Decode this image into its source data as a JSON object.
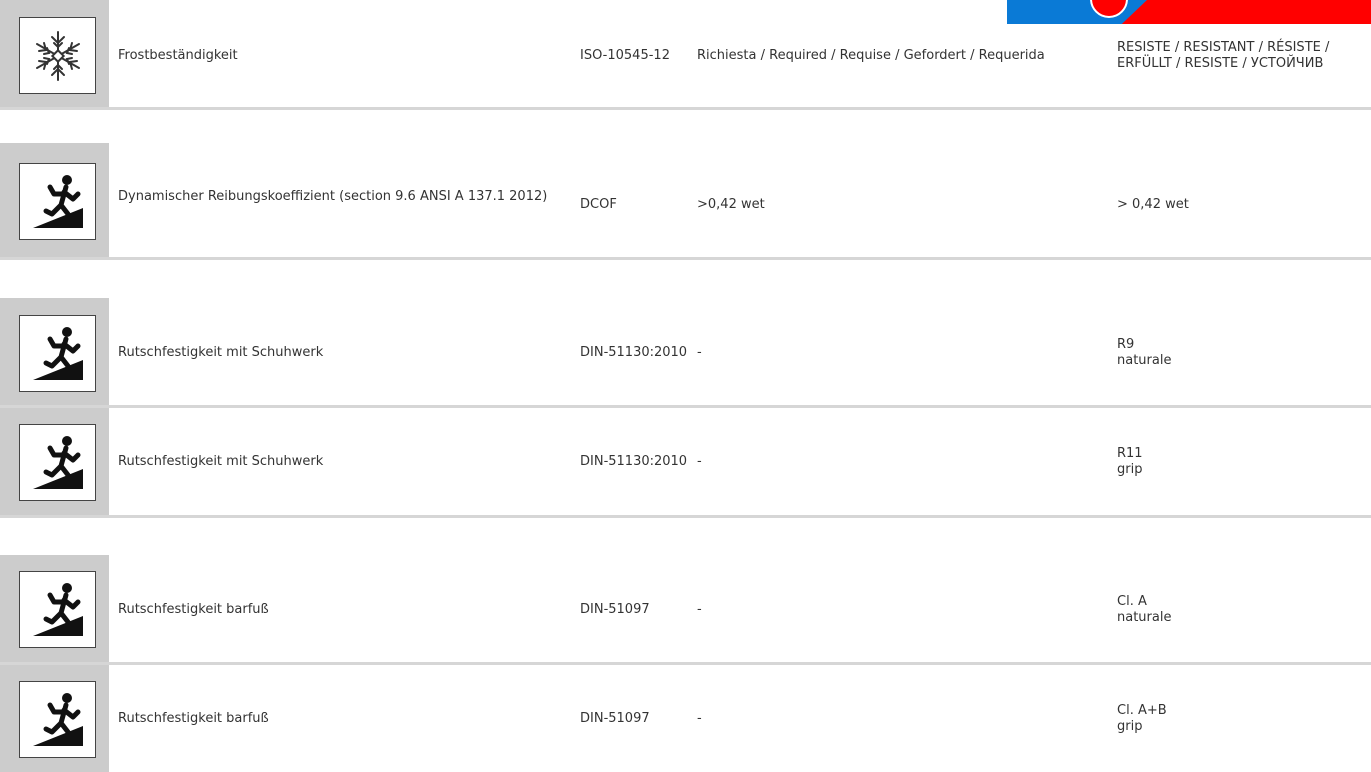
{
  "banner": {
    "colors": [
      "#0a7ad6",
      "#ff0000"
    ]
  },
  "rows": [
    {
      "icon": "snowflake-icon",
      "property": "Frostbeständigkeit",
      "norm": "ISO-10545-12",
      "requirement": "Richiesta / Required / Requise / Gefordert / Requerida",
      "value_line1": "RESISTE / RESISTANT / RÉSISTE /",
      "value_line2": "ERFÜLLT / RESISTE / УСТОЙЧИВ"
    },
    {
      "icon": "slip-hazard-icon",
      "property": "Dynamischer Reibungskoeffizient (section 9.6 ANSI A 137.1 2012)",
      "norm": "DCOF",
      "requirement": ">0,42 wet",
      "value_line1": "> 0,42 wet",
      "value_line2": ""
    },
    {
      "icon": "slip-hazard-icon",
      "property": "Rutschfestigkeit mit Schuhwerk",
      "norm": "DIN-51130:2010",
      "requirement": "-",
      "value_line1": "R9",
      "value_line2": "naturale"
    },
    {
      "icon": "slip-hazard-icon",
      "property": "Rutschfestigkeit mit Schuhwerk",
      "norm": "DIN-51130:2010",
      "requirement": "-",
      "value_line1": "R11",
      "value_line2": "grip"
    },
    {
      "icon": "slip-hazard-icon",
      "property": "Rutschfestigkeit barfuß",
      "norm": "DIN-51097",
      "requirement": "-",
      "value_line1": "Cl. A",
      "value_line2": "naturale"
    },
    {
      "icon": "slip-hazard-icon",
      "property": "Rutschfestigkeit barfuß",
      "norm": "DIN-51097",
      "requirement": "-",
      "value_line1": "Cl. A+B",
      "value_line2": "grip"
    }
  ]
}
